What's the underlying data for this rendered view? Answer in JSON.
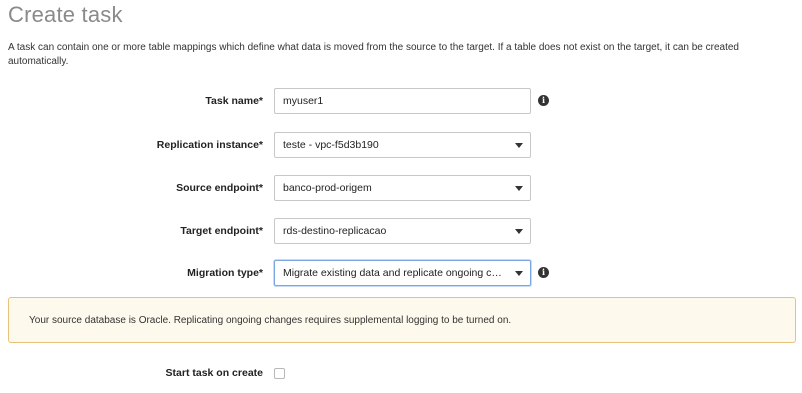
{
  "page": {
    "title": "Create task",
    "description": "A task can contain one or more table mappings which define what data is moved from the source to the target. If a table does not exist on the target, it can be created automatically."
  },
  "form": {
    "task_name": {
      "label": "Task name*",
      "value": "myuser1",
      "icon": "info-icon"
    },
    "replication_instance": {
      "label": "Replication instance*",
      "value": "teste - vpc-f5d3b190"
    },
    "source_endpoint": {
      "label": "Source endpoint*",
      "value": "banco-prod-origem"
    },
    "target_endpoint": {
      "label": "Target endpoint*",
      "value": "rds-destino-replicacao"
    },
    "migration_type": {
      "label": "Migration type*",
      "value": "Migrate existing data and replicate ongoing changes",
      "icon": "info-icon"
    },
    "start_task": {
      "label": "Start task on create",
      "checked": false
    }
  },
  "alert": {
    "text": "Your source database is Oracle. Replicating ongoing changes requires supplemental logging to be turned on."
  },
  "colors": {
    "alert_background": "#fdf9ec",
    "alert_border": "#e9c27a",
    "focus_border": "#7aa7e3"
  }
}
